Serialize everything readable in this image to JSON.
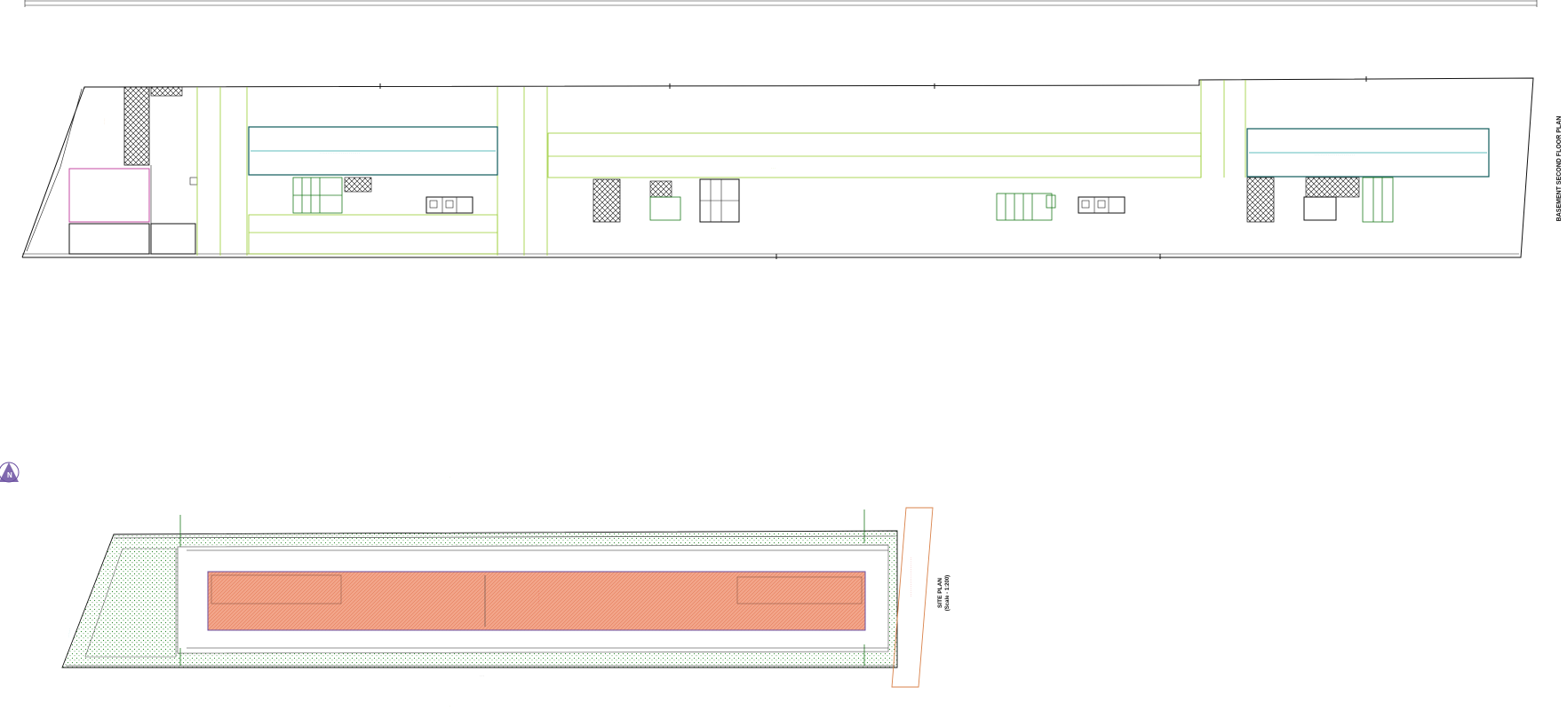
{
  "basement_plan": {
    "title": "BASEMENT SECOND FLOOR PLAN"
  },
  "site_plan": {
    "title": "SITE PLAN",
    "scale": "(Scale - 1:200)"
  },
  "north_arrow": {
    "letter": "N"
  },
  "colors": {
    "outline": "#111111",
    "core_green": "#9acd32",
    "teal_block": "#0e5a5a",
    "building_fill": "#f2a58a",
    "magenta": "#c0389a",
    "red_text": "#d21f1f",
    "north_arrow": "#6a4fa0"
  }
}
